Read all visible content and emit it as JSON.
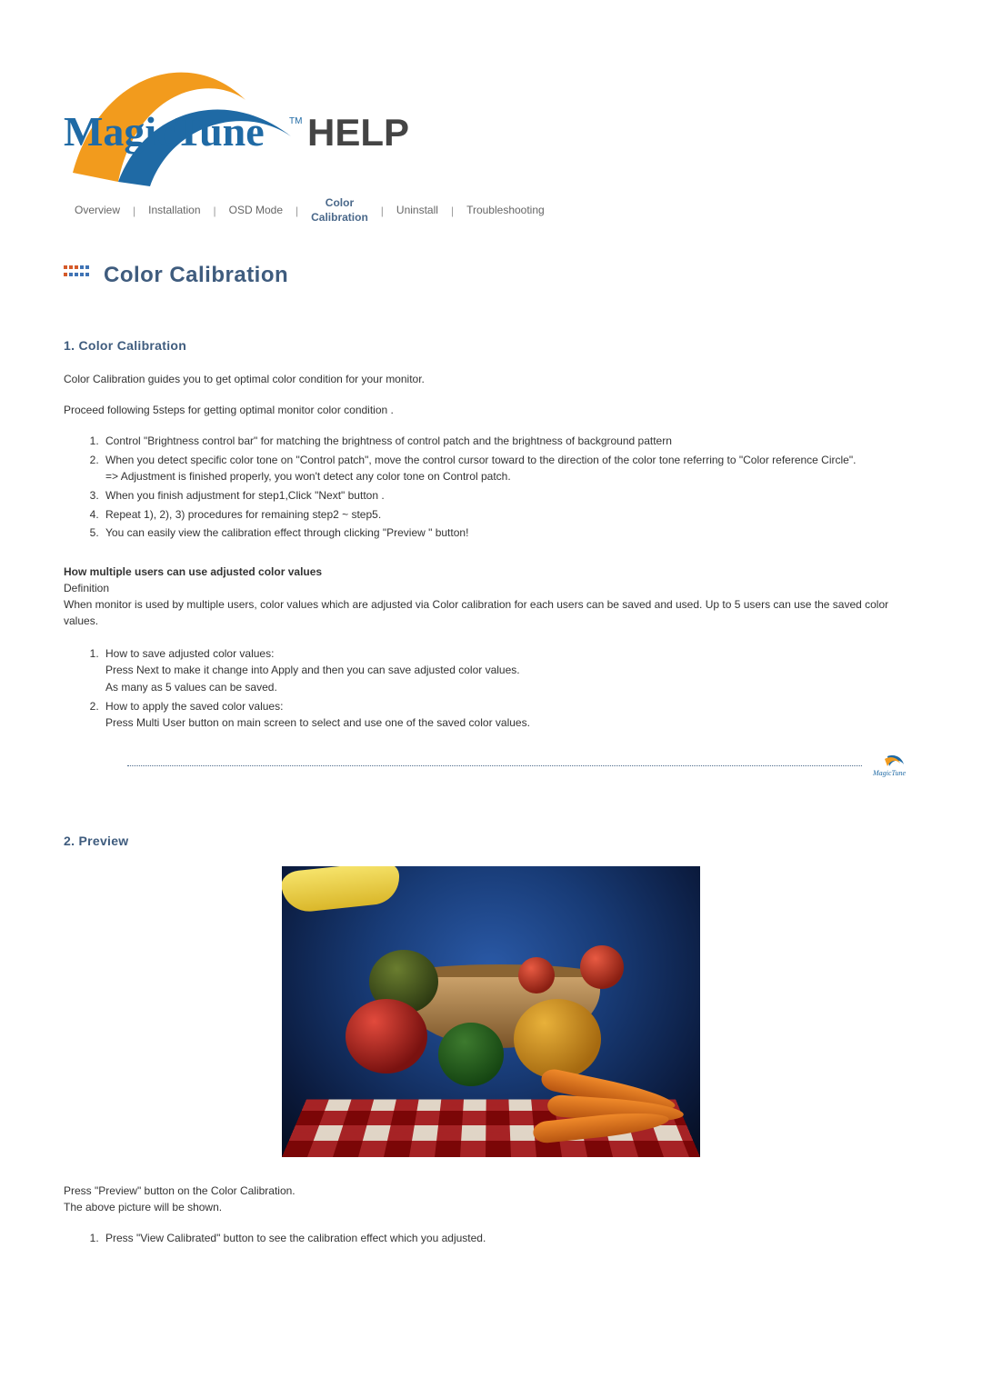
{
  "logo": {
    "brand": "MagicTune",
    "tm": "TM",
    "help": "HELP"
  },
  "nav": {
    "overview": "Overview",
    "installation": "Installation",
    "osd_mode": "OSD Mode",
    "color_calibration": "Color\nCalibration",
    "uninstall": "Uninstall",
    "troubleshooting": "Troubleshooting",
    "sep": "|"
  },
  "title": "Color Calibration",
  "section1": {
    "heading": "1. Color Calibration",
    "intro1": "Color Calibration guides you to get optimal color condition for your monitor.",
    "intro2": "Proceed following 5steps for getting optimal monitor color condition .",
    "steps": [
      "Control \"Brightness control bar\" for matching the brightness of control patch and the brightness of background pattern",
      "When you detect specific color tone on \"Control patch\", move the control cursor toward to the direction of the color tone referring to \"Color reference Circle\".\n=> Adjustment is finished properly, you won't detect any color tone on Control patch.",
      "When you finish adjustment for step1,Click \"Next\" button .",
      "Repeat 1), 2), 3) procedures for remaining step2 ~ step5.",
      "You can easily view the calibration effect through clicking \"Preview \" button!"
    ],
    "multi_users_h": "How multiple users can use adjusted color values",
    "definition_label": "Definition",
    "multi_users_body": "When monitor is used by multiple users, color values which are adjusted via Color calibration for each users can be saved and used. Up to 5 users can use the saved color values.",
    "multi_users_steps": [
      "How to save adjusted color values:\nPress Next to make it change into Apply and then you can save adjusted color values.\nAs many as 5 values can be saved.",
      "How to apply the saved color values:\nPress Multi User button on main screen to select and use one of the saved color values."
    ],
    "mini_logo_text": "MagicTune"
  },
  "section2": {
    "heading": "2. Preview",
    "caption1": "Press \"Preview\" button on the Color Calibration.",
    "caption2": "The above picture will be shown.",
    "steps": [
      "Press \"View Calibrated\" button to see the calibration effect which you adjusted."
    ]
  }
}
